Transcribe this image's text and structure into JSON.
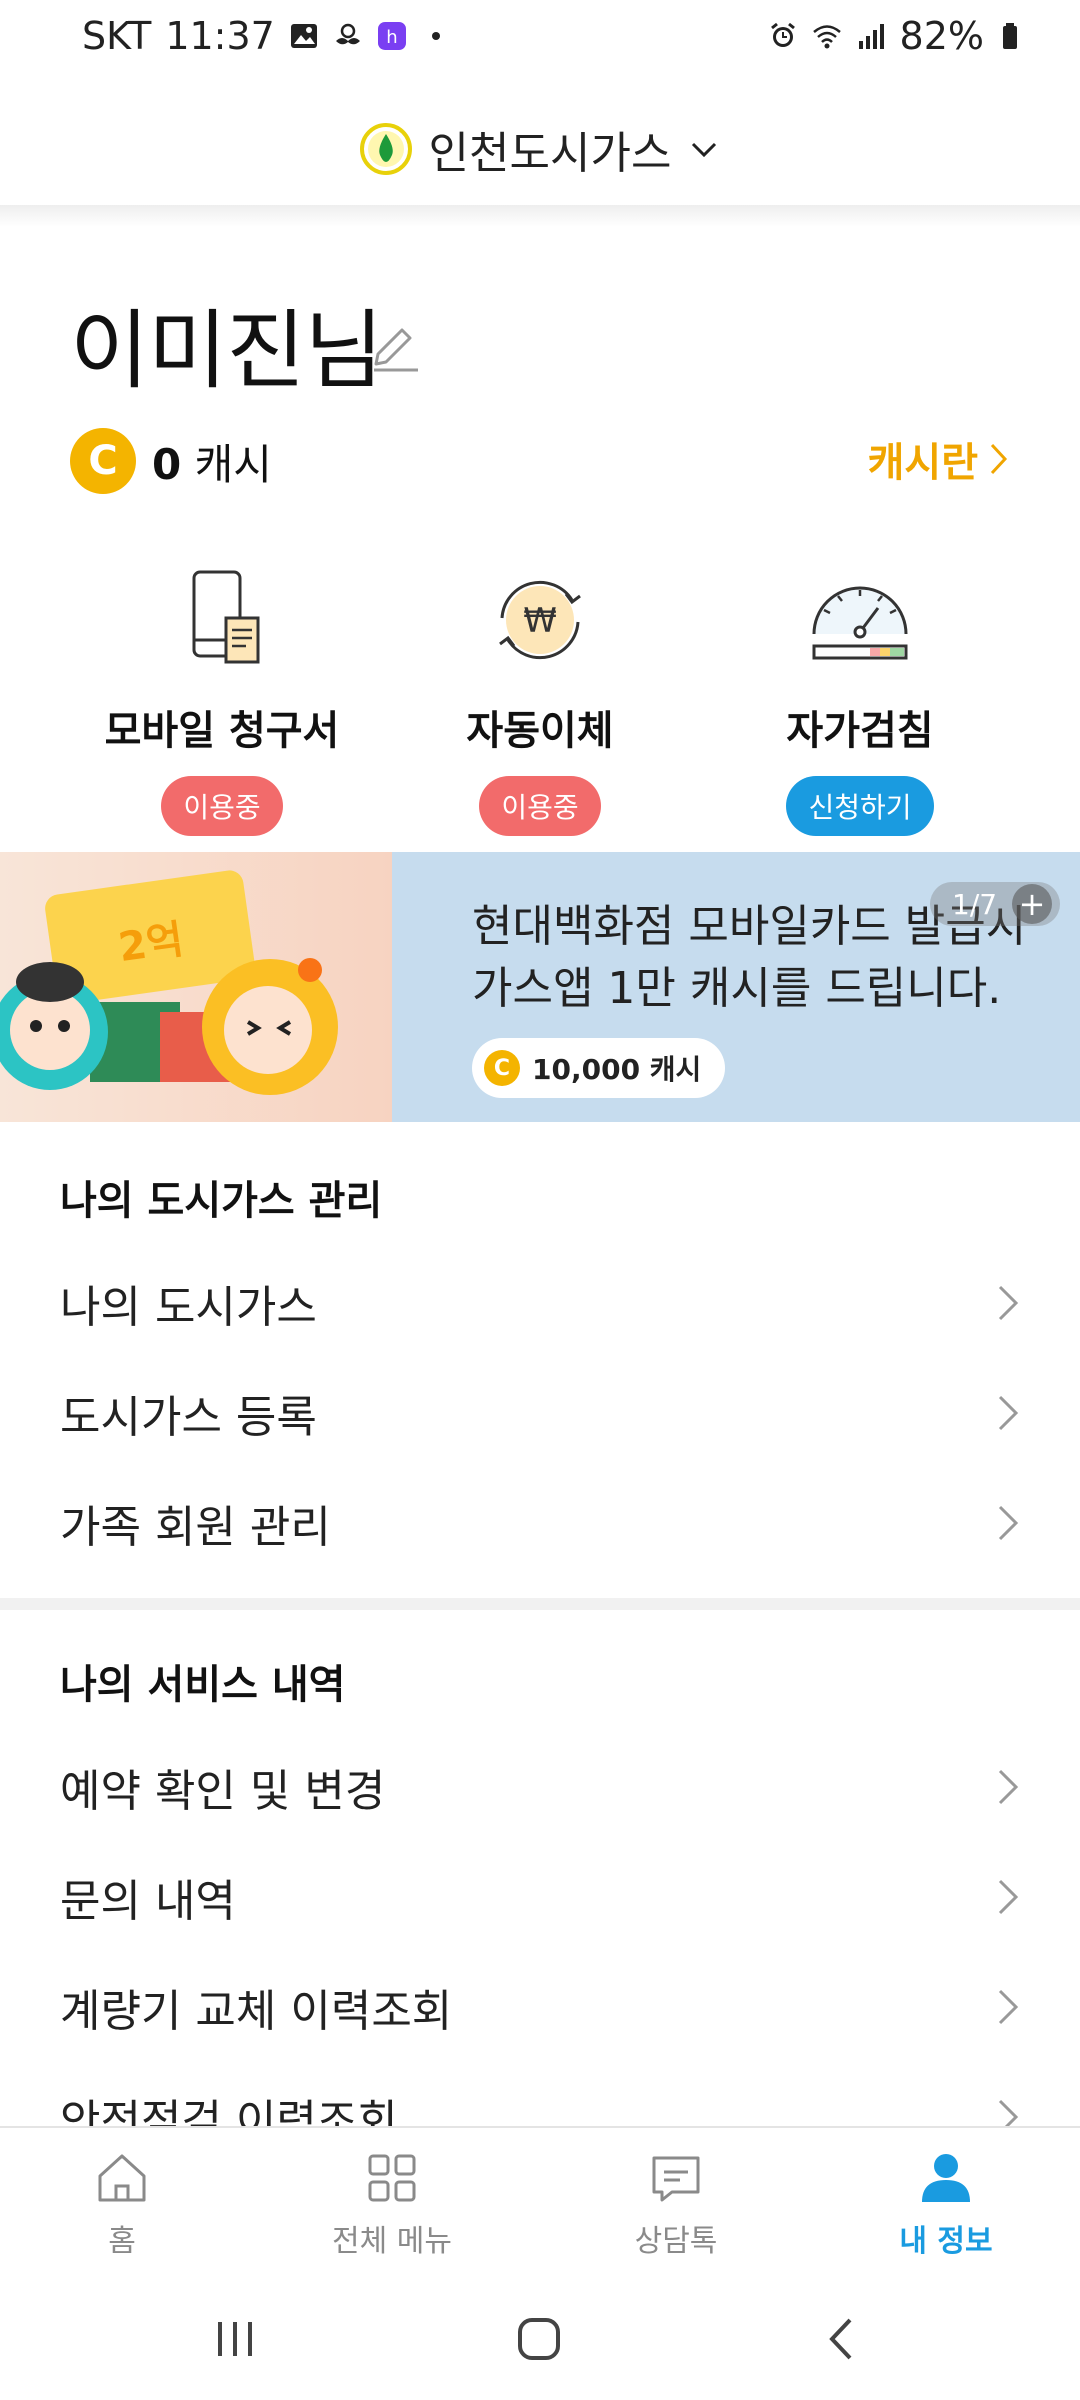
{
  "status_bar": {
    "carrier": "SKT",
    "time": "11:37",
    "battery": "82%"
  },
  "header": {
    "company": "인천도시가스"
  },
  "user": {
    "name": "이미진님",
    "cash_amount": "0",
    "cash_unit": "캐시",
    "coin_letter": "C",
    "cash_link": "캐시란"
  },
  "services": [
    {
      "label": "모바일 청구서",
      "status": "이용중",
      "icon": "mobile-bill-icon"
    },
    {
      "label": "자동이체",
      "status": "이용중",
      "icon": "auto-transfer-icon"
    },
    {
      "label": "자가검침",
      "status": "신청하기",
      "icon": "meter-gauge-icon"
    }
  ],
  "banner": {
    "line1": "현대백화점 모바일카드 발급시",
    "line2": "가스앱 1만 캐시를 드립니다.",
    "reward": "10,000 캐시",
    "counter": "1/7"
  },
  "section1": {
    "title": "나의 도시가스 관리",
    "items": [
      "나의 도시가스",
      "도시가스 등록",
      "가족 회원 관리"
    ]
  },
  "section2": {
    "title": "나의 서비스 내역",
    "items": [
      "예약 확인 및 변경",
      "문의 내역",
      "계량기 교체 이력조회",
      "안전점검 이력조회"
    ]
  },
  "bottom_nav": [
    {
      "label": "홈",
      "icon": "home-icon"
    },
    {
      "label": "전체 메뉴",
      "icon": "grid-menu-icon"
    },
    {
      "label": "상담톡",
      "icon": "chat-icon"
    },
    {
      "label": "내 정보",
      "icon": "person-icon",
      "active": true
    }
  ],
  "colors": {
    "accent_blue": "#1a9be0",
    "badge_red": "#f26b6b",
    "cash_gold": "#f0a500"
  }
}
